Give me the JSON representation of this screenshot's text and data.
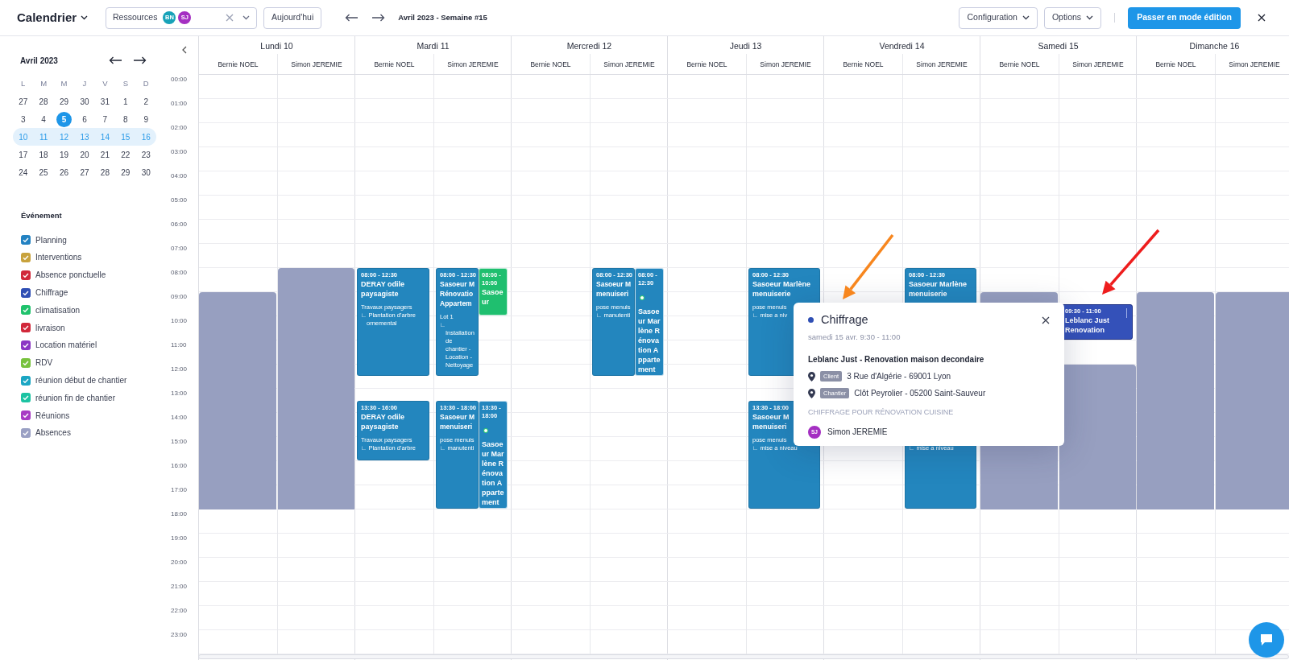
{
  "app": {
    "title": "Calendrier"
  },
  "toolbar": {
    "resources": {
      "label": "Ressources",
      "chips": [
        {
          "initials": "BN",
          "color": "#17a2b8"
        },
        {
          "initials": "SJ",
          "color": "#a42fc2"
        }
      ]
    },
    "today_button": "Aujourd'hui",
    "period": "Avril 2023 - Semaine #15",
    "menus": [
      "Configuration",
      "Options"
    ],
    "edit_button": "Passer en mode édition"
  },
  "mini_calendar": {
    "title": "Avril 2023",
    "weekdays": [
      "L",
      "M",
      "M",
      "J",
      "V",
      "S",
      "D"
    ],
    "weeks": [
      {
        "selected": false,
        "days": [
          {
            "label": "27",
            "today": false
          },
          {
            "label": "28",
            "today": false
          },
          {
            "label": "29",
            "today": false
          },
          {
            "label": "30",
            "today": false
          },
          {
            "label": "31",
            "today": false
          },
          {
            "label": "1",
            "today": false
          },
          {
            "label": "2",
            "today": false
          }
        ]
      },
      {
        "selected": false,
        "days": [
          {
            "label": "3",
            "today": false
          },
          {
            "label": "4",
            "today": false
          },
          {
            "label": "5",
            "today": true
          },
          {
            "label": "6",
            "today": false
          },
          {
            "label": "7",
            "today": false
          },
          {
            "label": "8",
            "today": false
          },
          {
            "label": "9",
            "today": false
          }
        ]
      },
      {
        "selected": true,
        "days": [
          {
            "label": "10",
            "today": false
          },
          {
            "label": "11",
            "today": false
          },
          {
            "label": "12",
            "today": false
          },
          {
            "label": "13",
            "today": false
          },
          {
            "label": "14",
            "today": false
          },
          {
            "label": "15",
            "today": false
          },
          {
            "label": "16",
            "today": false
          }
        ]
      },
      {
        "selected": false,
        "days": [
          {
            "label": "17",
            "today": false
          },
          {
            "label": "18",
            "today": false
          },
          {
            "label": "19",
            "today": false
          },
          {
            "label": "20",
            "today": false
          },
          {
            "label": "21",
            "today": false
          },
          {
            "label": "22",
            "today": false
          },
          {
            "label": "23",
            "today": false
          }
        ]
      },
      {
        "selected": false,
        "days": [
          {
            "label": "24",
            "today": false
          },
          {
            "label": "25",
            "today": false
          },
          {
            "label": "26",
            "today": false
          },
          {
            "label": "27",
            "today": false
          },
          {
            "label": "28",
            "today": false
          },
          {
            "label": "29",
            "today": false
          },
          {
            "label": "30",
            "today": false
          }
        ]
      }
    ]
  },
  "event_types": {
    "title": "Événement",
    "items": [
      {
        "label": "Planning",
        "color": "#2382c2",
        "checked": true
      },
      {
        "label": "Interventions",
        "color": "#c8a23c",
        "checked": true
      },
      {
        "label": "Absence ponctuelle",
        "color": "#d1283a",
        "checked": true
      },
      {
        "label": "Chiffrage",
        "color": "#2f4fb4",
        "checked": true
      },
      {
        "label": "climatisation",
        "color": "#20c26c",
        "checked": true
      },
      {
        "label": "livraison",
        "color": "#d1283a",
        "checked": true
      },
      {
        "label": "Location matériel",
        "color": "#8b37c4",
        "checked": true
      },
      {
        "label": "RDV",
        "color": "#78c23e",
        "checked": true
      },
      {
        "label": "réunion début de chantier",
        "color": "#1ba6c3",
        "checked": true
      },
      {
        "label": "réunion fin de chantier",
        "color": "#1cc3a2",
        "checked": true
      },
      {
        "label": "Réunions",
        "color": "#a83bc4",
        "checked": true
      },
      {
        "label": "Absences",
        "color": "#9aa0c4",
        "checked": true
      }
    ]
  },
  "hours": [
    "00:00",
    "01:00",
    "02:00",
    "03:00",
    "04:00",
    "05:00",
    "06:00",
    "07:00",
    "08:00",
    "09:00",
    "10:00",
    "11:00",
    "12:00",
    "13:00",
    "14:00",
    "15:00",
    "16:00",
    "17:00",
    "18:00",
    "19:00",
    "20:00",
    "21:00",
    "22:00",
    "23:00"
  ],
  "days": [
    {
      "label": "Lundi 10",
      "columns": [
        {
          "resource": "Bernie NOEL",
          "events": [
            {
              "kind": "absence"
            }
          ]
        },
        {
          "resource": "Simon JEREMIE",
          "events": [
            {
              "kind": "longabsence"
            }
          ]
        }
      ]
    },
    {
      "label": "Mardi 11",
      "columns": [
        {
          "resource": "Bernie NOEL",
          "events": [
            {
              "kind": "event",
              "color": "#2386be",
              "selected": false,
              "time": "08:00 - 12:30",
              "title_lines": [
                "DERAY odile",
                "paysagiste"
              ],
              "details": [
                "Travaux paysagers",
                "∟ Plantation d'arbre ornemental"
              ]
            },
            {
              "kind": "event",
              "color": "#2386be",
              "selected": false,
              "time": "13:30 - 16:00",
              "title_lines": [
                "DERAY odile",
                "paysagiste"
              ],
              "details": [
                "Travaux paysagers",
                "∟ Plantation d'arbre"
              ]
            }
          ]
        },
        {
          "resource": "Simon JEREMIE",
          "events": [
            {
              "kind": "event",
              "color": "#2386be",
              "selected": false,
              "time": "08:00 - 12:30",
              "title_lines": [
                "Sasoeur M",
                "Rénovatio",
                "Appartem"
              ],
              "details": [
                "Lot 1",
                "∟ Installation de chantier - Location - Nettoyage"
              ]
            },
            {
              "kind": "overlap",
              "color": "#1fbf6f",
              "selected": false,
              "dot": false,
              "time": "08:00 - 10:00",
              "title": "Sasoeur"
            },
            {
              "kind": "event",
              "color": "#2386be",
              "selected": false,
              "time": "13:30 - 18:00",
              "title_lines": [
                "Sasoeur M",
                "menuiseri"
              ],
              "details": [
                "pose menuis",
                "∟ manutenti"
              ]
            },
            {
              "kind": "overlap",
              "color": "#2386be",
              "selected": false,
              "dot": true,
              "time": "13:30 - 18:00",
              "title": "Sasoeur Marlène Rénovation Appartement"
            }
          ]
        }
      ]
    },
    {
      "label": "Mercredi 12",
      "columns": [
        {
          "resource": "Bernie NOEL"
        },
        {
          "resource": "Simon JEREMIE",
          "events": [
            {
              "kind": "event",
              "color": "#2386be",
              "selected": false,
              "time": "08:00 - 12:30",
              "title_lines": [
                "Sasoeur M",
                "menuiseri"
              ],
              "details": [
                "pose menuis",
                "∟ manutenti"
              ]
            },
            {
              "kind": "overlap",
              "color": "#2386be",
              "selected": false,
              "dot": true,
              "time": "08:00 - 12:30",
              "title": "Sasoeur Marlène Rénovation Appartement"
            }
          ]
        }
      ]
    },
    {
      "label": "Jeudi 13",
      "columns": [
        {
          "resource": "Bernie NOEL"
        },
        {
          "resource": "Simon JEREMIE",
          "events": [
            {
              "kind": "event",
              "color": "#2386be",
              "selected": false,
              "time": "08:00 - 12:30",
              "title_lines": [
                "Sasoeur Marlène",
                "menuiserie"
              ],
              "details": [
                "pose menuis",
                "∟ mise a niv"
              ]
            },
            {
              "kind": "event",
              "color": "#2386be",
              "selected": false,
              "time": "13:30 - 18:00",
              "title_lines": [
                "Sasoeur M",
                "menuiseri"
              ],
              "details": [
                "pose menuis",
                "∟ mise a niveau"
              ]
            }
          ]
        }
      ]
    },
    {
      "label": "Vendredi 14",
      "columns": [
        {
          "resource": "Bernie NOEL"
        },
        {
          "resource": "Simon JEREMIE",
          "events": [
            {
              "kind": "event",
              "color": "#2386be",
              "selected": false,
              "time": "08:00 - 12:30",
              "title_lines": [
                "Sasoeur Marlène",
                "menuiserie"
              ]
            },
            {
              "kind": "afternoon",
              "color": "#2386be",
              "selected": false,
              "details": [
                "∟ mise a niveau"
              ]
            }
          ]
        }
      ]
    },
    {
      "label": "Samedi 15",
      "columns": [
        {
          "resource": "Bernie NOEL",
          "events": [
            {
              "kind": "absence"
            }
          ]
        },
        {
          "resource": "Simon JEREMIE",
          "events": [
            {
              "kind": "event",
              "color": "#3451b9",
              "selected": true,
              "time": "09:30 - 11:00",
              "title_lines": [
                "Leblanc Just",
                "Renovation"
              ]
            },
            {
              "kind": "halfabsence"
            }
          ]
        }
      ]
    },
    {
      "label": "Dimanche 16",
      "columns": [
        {
          "resource": "Bernie NOEL",
          "events": [
            {
              "kind": "absence"
            }
          ]
        },
        {
          "resource": "Simon JEREMIE",
          "events": [
            {
              "kind": "absence"
            }
          ]
        }
      ]
    }
  ],
  "popup": {
    "color": "#2f4fb4",
    "title": "Chiffrage",
    "date": "samedi 15 avr. 9:30 - 11:00",
    "subject": "Leblanc Just - Renovation maison decondaire",
    "addresses": [
      {
        "tag": "Client",
        "text": "3 Rue d'Algérie - 69001 Lyon"
      },
      {
        "tag": "Chantier",
        "text": "Clôt Peyrolier - 05200 Saint-Sauveur"
      }
    ],
    "note": "CHIFFRAGE POUR RÉNOVATION CUISINE",
    "assignee": {
      "initials": "SJ",
      "name": "Simon JEREMIE",
      "color": "#a42fc2"
    }
  },
  "annotations": [
    {
      "kind": "popuparrow",
      "color": "#f7861e"
    },
    {
      "kind": "eventarrow",
      "color": "#ee1d1d"
    }
  ]
}
